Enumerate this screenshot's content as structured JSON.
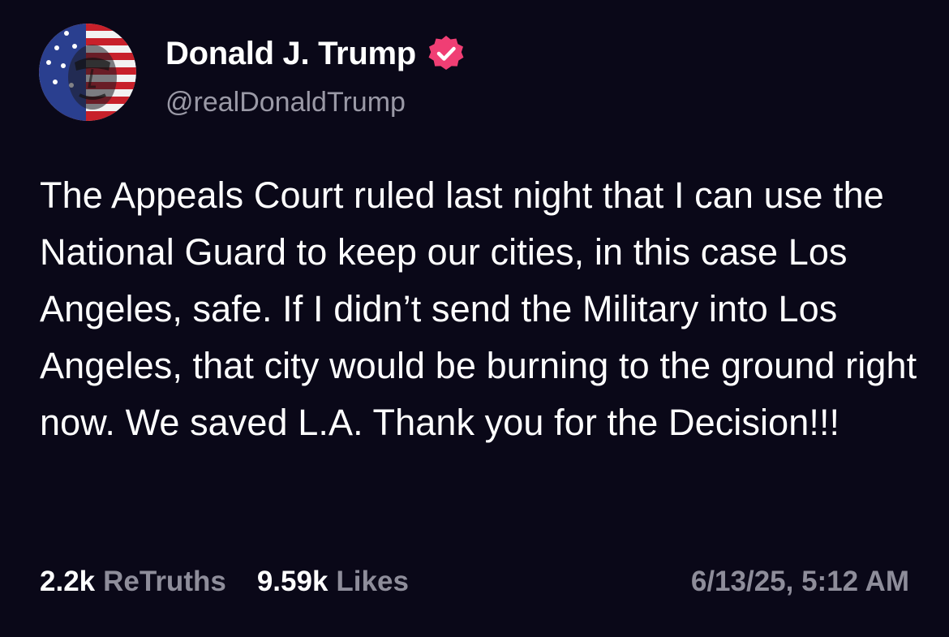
{
  "user": {
    "display_name": "Donald J. Trump",
    "handle": "@realDonaldTrump",
    "verified_icon": "verified-badge-icon",
    "avatar_icon": "avatar"
  },
  "post": {
    "text": "The Appeals Court ruled last night that I can use the National Guard to keep our cities, in this case Los Angeles, safe. If I didn’t send the Military into Los Angeles, that city would be burning to the ground right now. We saved L.A. Thank you for the Decision!!!"
  },
  "stats": {
    "retruths_count": "2.2k",
    "retruths_label": "ReTruths",
    "likes_count": "9.59k",
    "likes_label": "Likes"
  },
  "timestamp": "6/13/25, 5:12 AM",
  "colors": {
    "background": "#0a0818",
    "text": "#ffffff",
    "muted": "#8e8d9a",
    "verified": "#f03e74"
  }
}
